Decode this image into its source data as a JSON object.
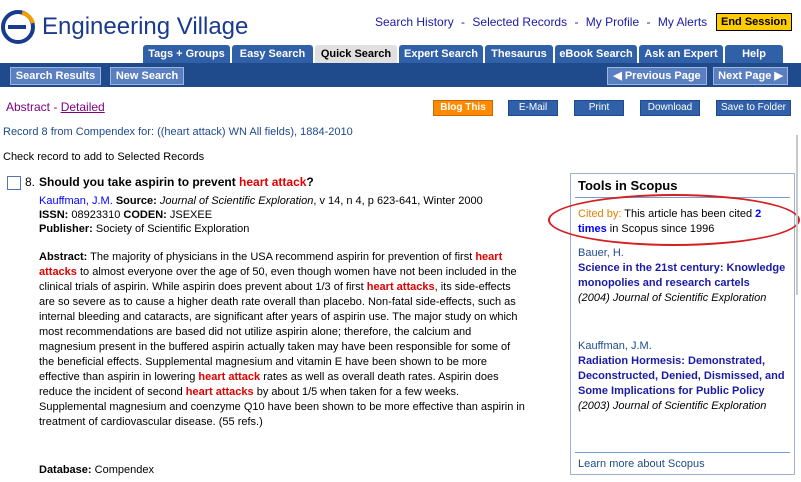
{
  "app": {
    "brand": "Engineering Village"
  },
  "top_links": {
    "search_history": "Search History",
    "selected_records": "Selected Records",
    "my_profile": "My Profile",
    "my_alerts": "My Alerts",
    "separator": "-"
  },
  "end_session": "End Session",
  "tabs": [
    {
      "label": "Tags + Groups"
    },
    {
      "label": "Easy Search"
    },
    {
      "label": "Quick Search"
    },
    {
      "label": "Expert Search"
    },
    {
      "label": "Thesaurus"
    },
    {
      "label": "eBook Search"
    },
    {
      "label": "Ask an Expert"
    },
    {
      "label": "Help"
    }
  ],
  "navbar": {
    "search_results": "Search Results",
    "new_search": "New Search",
    "previous_page": "◀ Previous Page",
    "next_page": "Next Page ▶"
  },
  "view": {
    "abstract": "Abstract",
    "sep": "-",
    "detailed": "Detailed"
  },
  "actions": {
    "blog": "Blog This",
    "email": "E-Mail",
    "print": "Print",
    "download": "Download",
    "save": "Save to Folder"
  },
  "record_info": "Record 8 from Compendex for: ((heart attack) WN All fields), 1884-2010",
  "check_info": "Check record to add to Selected Records",
  "record": {
    "number": "8.",
    "title_pre": "Should you take aspirin to prevent ",
    "title_hl": "heart attack",
    "title_post": "?",
    "author": "Kauffman, J.M.",
    "source_label": "Source:",
    "source_journal": "Journal of Scientific Exploration",
    "source_rest": ", v 14, n 4, p 623-641, Winter 2000",
    "issn_label": "ISSN:",
    "issn": "08923310",
    "coden_label": "CODEN:",
    "coden": "JSEXEE",
    "publisher_label": "Publisher:",
    "publisher": "Society of Scientific Exploration",
    "abstract_label": "Abstract:",
    "abstract_1": " The majority of physicians in the USA recommend aspirin for prevention of first ",
    "abstract_hl1": "heart attacks",
    "abstract_2": " to almost everyone over the age of 50, even though women have not been included in the clinical trials of aspirin. While aspirin does prevent about 1/3 of first ",
    "abstract_hl2": "heart attacks",
    "abstract_3": ", its side-effects are so severe as to cause a higher death rate overall than placebo. Non-fatal side-effects, such as internal bleeding and cataracts, are significant after years of aspirin use. The major study on which most recommendations are based did not utilize aspirin alone; therefore, the calcium and magnesium present in the buffered aspirin actually taken may have been responsible for some of the beneficial effects. Supplemental magnesium and vitamin E have been shown to be more effective than aspirin in lowering ",
    "abstract_hl3": "heart attack",
    "abstract_4": " rates as well as overall death rates. Aspirin does reduce the incident of second ",
    "abstract_hl4": "heart attacks",
    "abstract_5": " by about 1/5 when taken for a few weeks. Supplemental magnesium and coenzyme Q10 have been shown to be more effective than aspirin in treatment of cardiovascular disease. (55 refs.)",
    "database_label": "Database:",
    "database": "Compendex"
  },
  "scopus": {
    "title": "Tools in Scopus",
    "cited_label": "Cited by:",
    "cited_text": " This article has been cited ",
    "cited_link": "2 times",
    "cited_tail": " in Scopus since 1996",
    "refs": [
      {
        "author": "Bauer, H.",
        "title": "Science in the 21st century: Knowledge monopolies and research cartels",
        "source": "(2004) Journal of Scientific Exploration"
      },
      {
        "author": "Kauffman, J.M.",
        "title": "Radiation Hormesis: Demonstrated, Deconstructed, Denied, Dismissed, and Some Implications for Public Policy",
        "source": "(2003) Journal of Scientific Exploration"
      }
    ],
    "learn_more": "Learn more about Scopus"
  },
  "colors": {
    "brand": "#1a3a8f",
    "navbar": "#1f4a8c",
    "tab": "#3060a8",
    "highlight": "#e00000",
    "end_session": "#ffcc00",
    "blog": "#ff8a00",
    "cited_oval": "#d42020"
  }
}
